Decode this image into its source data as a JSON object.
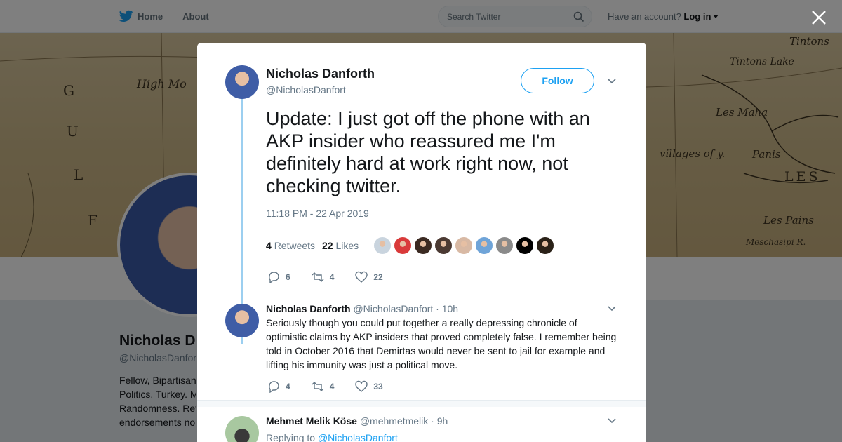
{
  "nav": {
    "home_label": "Home",
    "about_label": "About",
    "search_placeholder": "Search Twitter",
    "account_prefix": "Have an account?",
    "login_label": "Log in"
  },
  "banner_map": {
    "labels": [
      "Tintons",
      "Tintons Lake",
      "Les Maha",
      "villages of y.",
      "Panis",
      "LES",
      "Les Pains",
      "Meschasipi R.",
      "High Mo",
      "G",
      "U",
      "L",
      "F"
    ]
  },
  "profile": {
    "name": "Nicholas Da",
    "handle": "@NicholasDanfort",
    "bio_lines": [
      "Fellow, Bipartisan",
      "Politics. Turkey. M",
      "Randomness. Ret",
      "endorsements nor"
    ]
  },
  "tweet": {
    "author_name": "Nicholas Danforth",
    "author_handle": "@NicholasDanfort",
    "follow_label": "Follow",
    "text": "Update: I just got off the phone with an AKP insider who reassured me I'm definitely hard at work right now, not checking twitter.",
    "timestamp": "11:18 PM - 22 Apr 2019",
    "retweets_count": "4",
    "retweets_label": "Retweets",
    "likes_count": "22",
    "likes_label": "Likes",
    "liker_colors": [
      "#c9d4de",
      "#d93a3a",
      "#3b2a22",
      "#4b3a33",
      "#d8b9a4",
      "#6fa4d8",
      "#8a8a8a",
      "#000000",
      "#2a2118"
    ],
    "actions": {
      "replies": "6",
      "retweets": "4",
      "likes": "22"
    }
  },
  "replies": [
    {
      "name": "Nicholas Danforth",
      "handle": "@NicholasDanfort",
      "time": "· 10h",
      "text": "Seriously though you could put together a really depressing chronicle of optimistic claims by AKP insiders that proved completely false. I remember being told in October 2016 that Demirtas would never be sent to jail for example and lifting his immunity was just a political move.",
      "actions": {
        "replies": "4",
        "retweets": "4",
        "likes": "33"
      }
    },
    {
      "name": "Mehmet Melik Köse",
      "handle": "@mehmetmelik",
      "time": "· 9h",
      "replying_prefix": "Replying to",
      "replying_to": "@NicholasDanfort"
    }
  ],
  "colors": {
    "accent": "#1da1f2",
    "thread_line": "#9ccff0",
    "muted": "#657786"
  }
}
